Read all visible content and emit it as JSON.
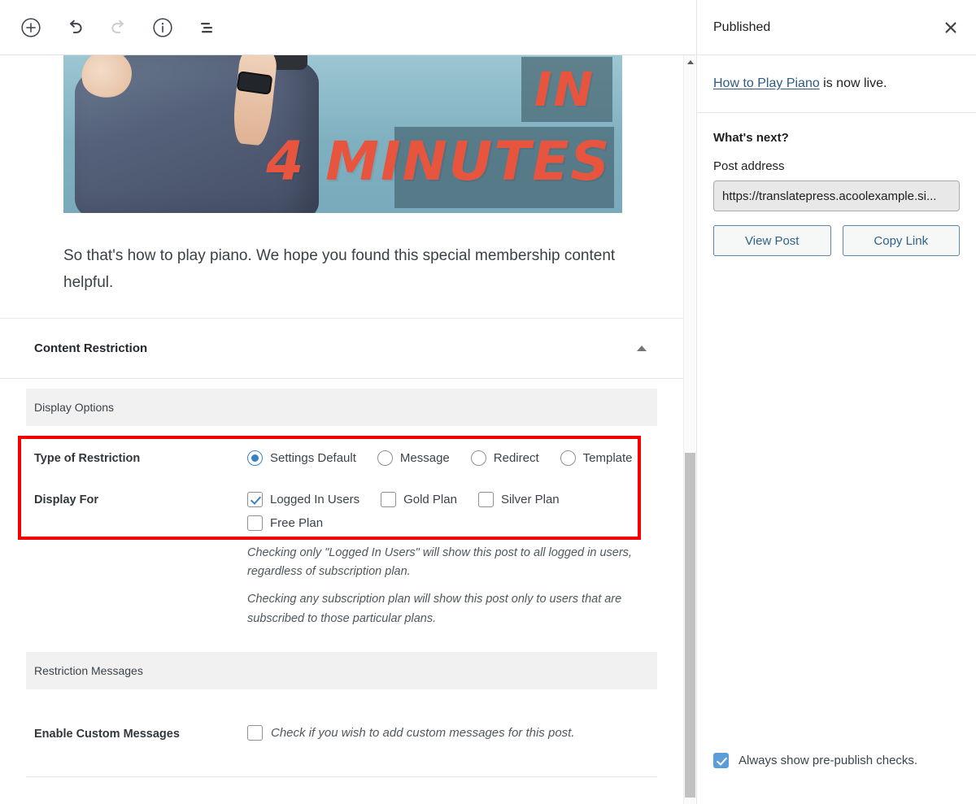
{
  "toolbar": {
    "buttons": [
      {
        "name": "add-block-button",
        "icon": "plus-circle-icon",
        "label": "Add block"
      },
      {
        "name": "undo-button",
        "icon": "undo-icon",
        "label": "Undo"
      },
      {
        "name": "redo-button",
        "icon": "redo-icon",
        "label": "Redo",
        "disabled": true
      },
      {
        "name": "details-button",
        "icon": "info-circle-icon",
        "label": "Details"
      },
      {
        "name": "list-view-button",
        "icon": "list-view-icon",
        "label": "List view"
      }
    ]
  },
  "editor": {
    "image_block": {
      "alt": "Man in denim shirt with overlaid text",
      "overlay_word_1": "IN",
      "overlay_word_2": "4 MINUTES"
    },
    "paragraph": "So that's how to play piano. We hope you found this special membership content helpful."
  },
  "metabox": {
    "title": "Content Restriction",
    "toggle_icon": "chevron-up-icon",
    "display_options_heading": "Display Options",
    "type_of_restriction": {
      "label": "Type of Restriction",
      "options": [
        {
          "label": "Settings Default",
          "selected": true
        },
        {
          "label": "Message",
          "selected": false
        },
        {
          "label": "Redirect",
          "selected": false
        },
        {
          "label": "Template",
          "selected": false
        }
      ]
    },
    "display_for": {
      "label": "Display For",
      "options": [
        {
          "label": "Logged In Users",
          "checked": true
        },
        {
          "label": "Gold Plan",
          "checked": false
        },
        {
          "label": "Silver Plan",
          "checked": false
        },
        {
          "label": "Free Plan",
          "checked": false
        }
      ]
    },
    "help_texts": [
      "Checking only \"Logged In Users\" will show this post to all logged in users, regardless of subscription plan.",
      "Checking any subscription plan will show this post only to users that are subscribed to those particular plans."
    ],
    "restriction_messages_heading": "Restriction Messages",
    "enable_custom_messages": {
      "label": "Enable Custom Messages",
      "description": "Check if you wish to add custom messages for this post.",
      "checked": false
    },
    "highlight_color": "#f50000"
  },
  "sidebar": {
    "title": "Published",
    "close_icon": "close-icon",
    "live_link_text": "How to Play Piano",
    "live_suffix": " is now live.",
    "whats_next_heading": "What's next?",
    "post_address_label": "Post address",
    "post_address_value": "https://translatepress.acoolexample.si...",
    "view_post_label": "View Post",
    "copy_link_label": "Copy Link",
    "prepublish_checkbox": {
      "label": "Always show pre-publish checks.",
      "checked": true
    },
    "accent_color": "#2f6287"
  },
  "scrollbar": {
    "up_arrow_icon": "triangle-up-icon"
  }
}
